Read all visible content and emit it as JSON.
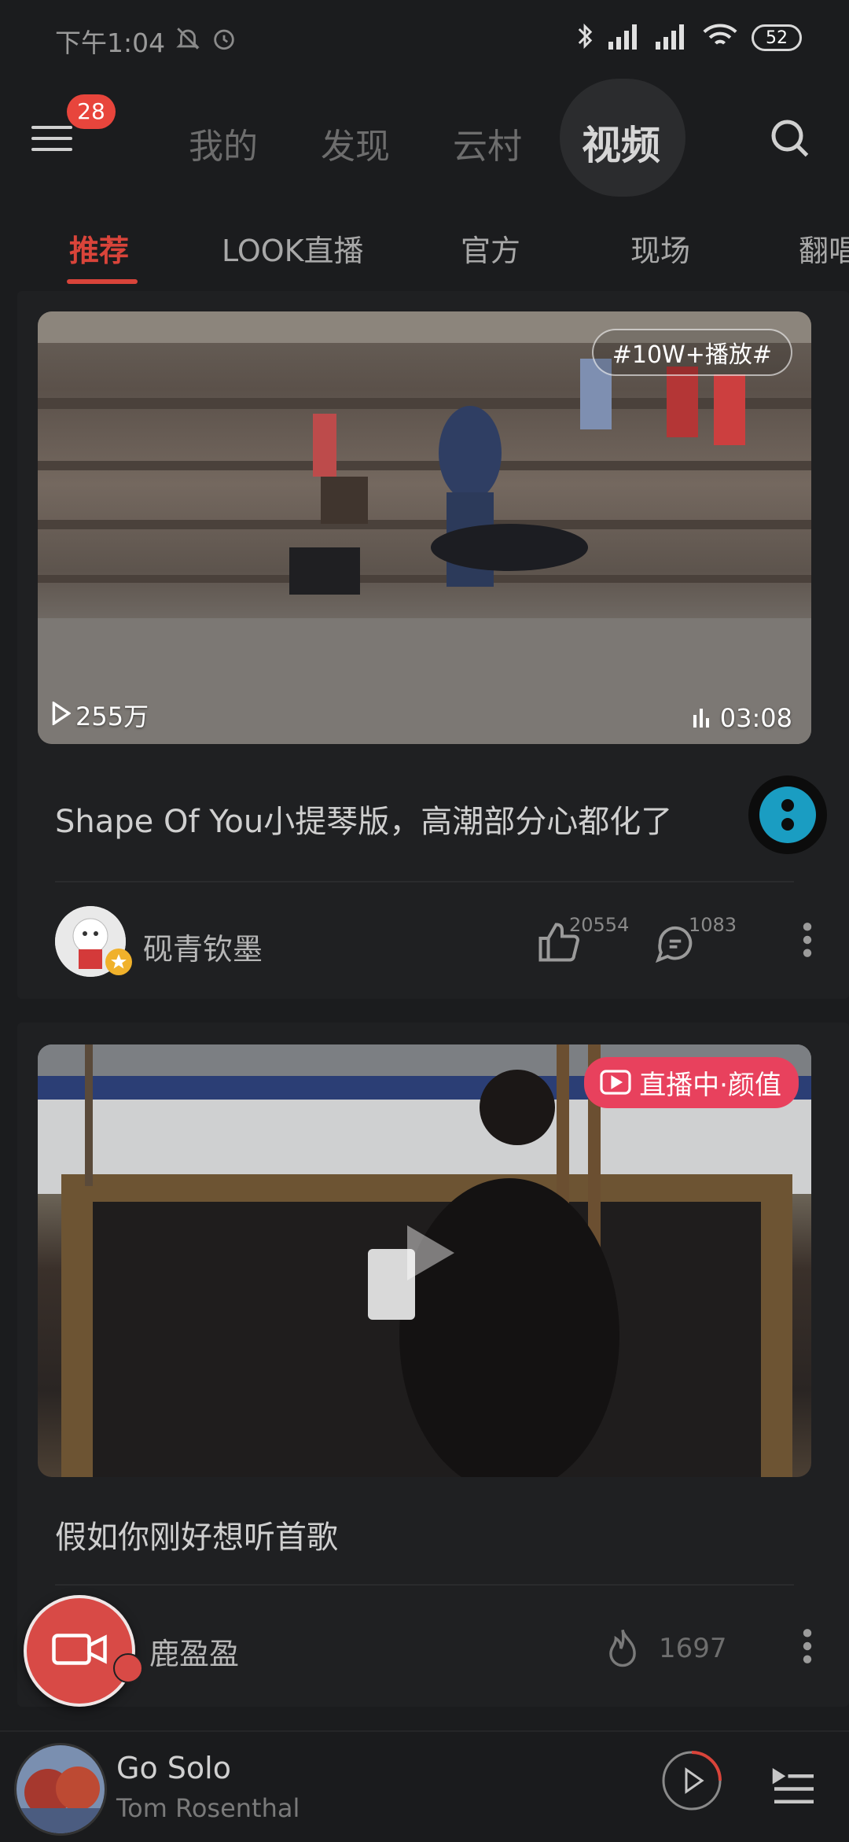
{
  "status_bar": {
    "time": "下午1:04",
    "battery": "52"
  },
  "top_nav": {
    "badge_count": "28",
    "tabs": [
      {
        "label": "我的"
      },
      {
        "label": "发现"
      },
      {
        "label": "云村"
      },
      {
        "label": "视频"
      }
    ]
  },
  "categories": [
    {
      "label": "推荐"
    },
    {
      "label": "LOOK直播"
    },
    {
      "label": "官方"
    },
    {
      "label": "现场"
    },
    {
      "label": "翻唱"
    }
  ],
  "feed": [
    {
      "tag": "#10W+播放#",
      "plays": "255万",
      "duration": "03:08",
      "title": "Shape Of You小提琴版，高潮部分心都化了",
      "author": "砚青钦墨",
      "likes": "20554",
      "comments": "1083"
    },
    {
      "live_label": "直播中·颜值",
      "title": "假如你刚好想听首歌",
      "author": "鹿盈盈",
      "heat": "1697"
    }
  ],
  "player": {
    "song": "Go Solo",
    "artist": "Tom Rosenthal"
  },
  "colors": {
    "accent": "#d9443a",
    "live": "#e8415d",
    "background": "#1b1c1e"
  }
}
